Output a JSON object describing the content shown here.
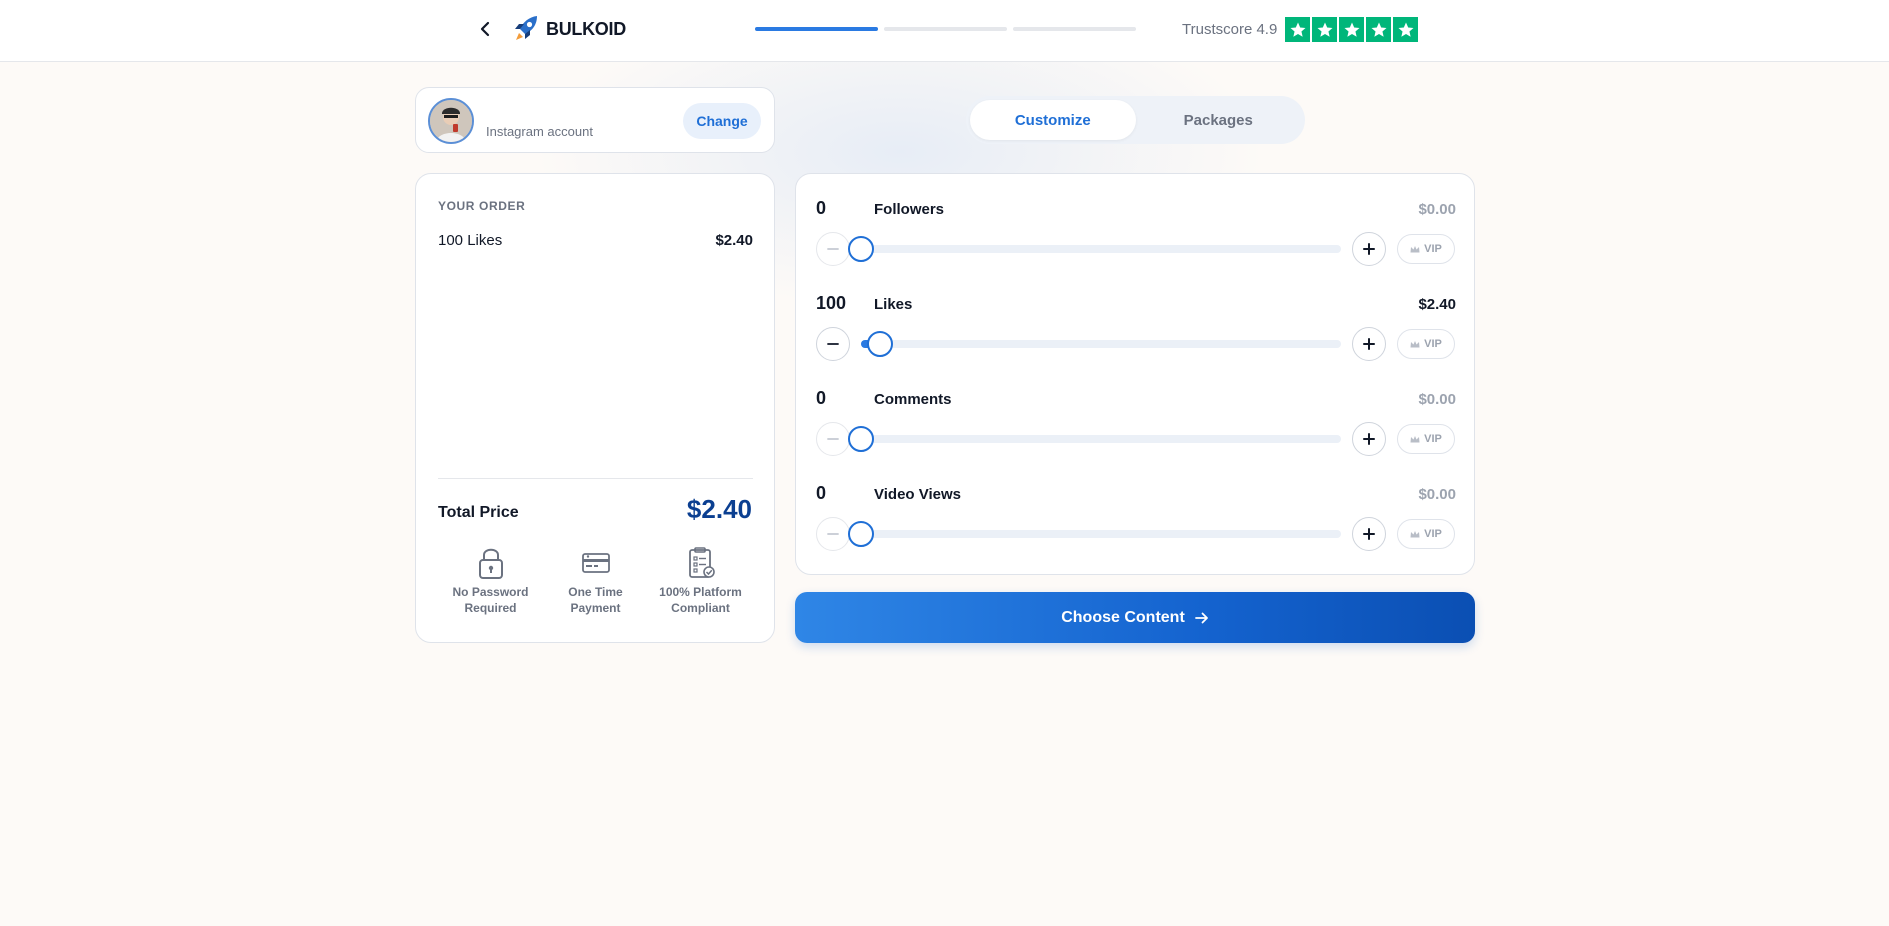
{
  "header": {
    "brand": "BULKOID",
    "trust_text": "Trustscore 4.9",
    "star_count": 5,
    "progress_steps": 3,
    "progress_active_step": 1,
    "trust_color": "#00b67a"
  },
  "account": {
    "label": "Instagram account",
    "change_label": "Change"
  },
  "tabs": [
    {
      "label": "Customize",
      "active": true
    },
    {
      "label": "Packages",
      "active": false
    }
  ],
  "order": {
    "heading": "YOUR ORDER",
    "items": [
      {
        "name": "100 Likes",
        "price": "$2.40"
      }
    ],
    "total_label": "Total Price",
    "total_value": "$2.40",
    "features": [
      {
        "icon": "lock-icon",
        "label": "No Password Required"
      },
      {
        "icon": "credit-card-icon",
        "label": "One Time Payment"
      },
      {
        "icon": "clipboard-check-icon",
        "label": "100% Platform Compliant"
      }
    ]
  },
  "services": [
    {
      "quantity": "0",
      "name": "Followers",
      "price": "$0.00",
      "level": 0.0,
      "active": false,
      "vip_label": "VIP"
    },
    {
      "quantity": "100",
      "name": "Likes",
      "price": "$2.40",
      "level": 0.04,
      "active": true,
      "vip_label": "VIP"
    },
    {
      "quantity": "0",
      "name": "Comments",
      "price": "$0.00",
      "level": 0.0,
      "active": false,
      "vip_label": "VIP"
    },
    {
      "quantity": "0",
      "name": "Video Views",
      "price": "$0.00",
      "level": 0.0,
      "active": false,
      "vip_label": "VIP"
    }
  ],
  "cta": {
    "label": "Choose Content"
  },
  "colors": {
    "accent": "#1f6fd6",
    "total": "#0b3f91"
  }
}
